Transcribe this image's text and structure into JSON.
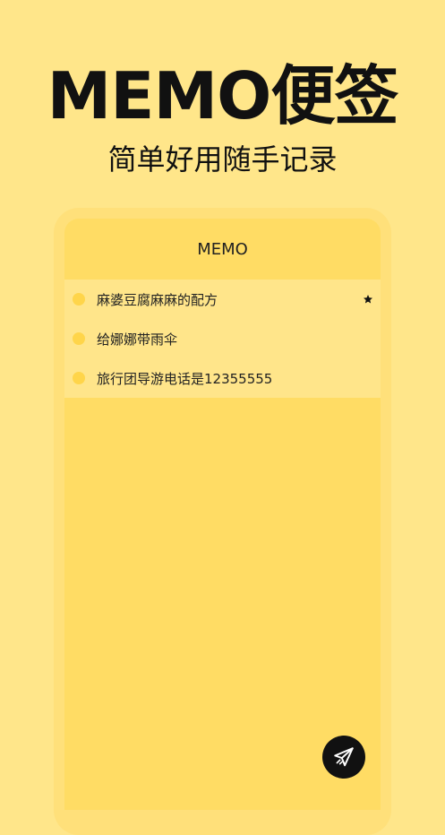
{
  "promo": {
    "title": "MEMO便签",
    "subtitle": "简单好用随手记录"
  },
  "app": {
    "header_title": "MEMO",
    "memos": [
      {
        "text": "麻婆豆腐麻麻的配方",
        "starred": true
      },
      {
        "text": "给娜娜带雨伞",
        "starred": false
      },
      {
        "text": "旅行团导游电话是12355555",
        "starred": false
      }
    ],
    "fab_icon": "send-icon"
  },
  "colors": {
    "background": "#FFE68A",
    "screen": "#FFDC64",
    "list": "#FFE58A",
    "dot": "#FFD54A",
    "fab": "#111111"
  }
}
